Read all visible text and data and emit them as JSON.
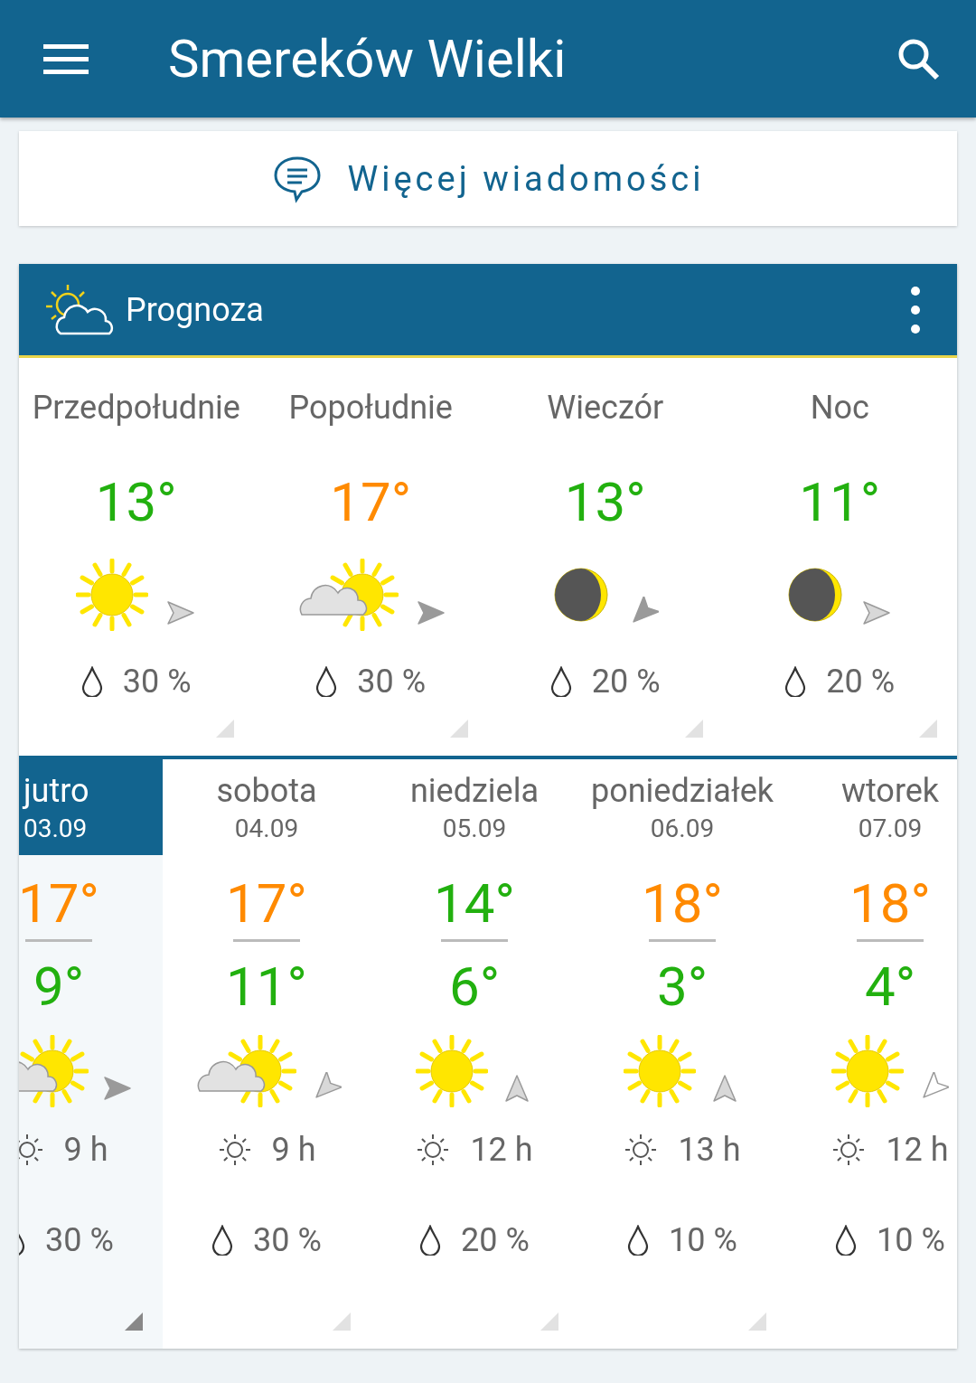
{
  "app_bar": {
    "title": "Smereków Wielki"
  },
  "news_card": {
    "label": "Więcej wiadomości"
  },
  "forecast": {
    "title": "Prognoza",
    "periods": [
      {
        "label": "Przedpołudnie",
        "temp": "13°",
        "color": "#22b00f",
        "precip": "30 %"
      },
      {
        "label": "Popołudnie",
        "temp": "17°",
        "color": "#ff8a00",
        "precip": "30 %"
      },
      {
        "label": "Wieczór",
        "temp": "13°",
        "color": "#22b00f",
        "precip": "20 %"
      },
      {
        "label": "Noc",
        "temp": "11°",
        "color": "#22b00f",
        "precip": "20 %"
      }
    ],
    "days": [
      {
        "name": "jutro",
        "date": "03.09",
        "selected": true,
        "max": "17°",
        "color": "#ff8a00",
        "min": "9°",
        "sun": "9 h",
        "precip": "30 %"
      },
      {
        "name": "sobota",
        "date": "04.09",
        "selected": false,
        "max": "17°",
        "color": "#ff8a00",
        "min": "11°",
        "sun": "9 h",
        "precip": "30 %"
      },
      {
        "name": "niedziela",
        "date": "05.09",
        "selected": false,
        "max": "14°",
        "color": "#22b00f",
        "min": "6°",
        "sun": "12 h",
        "precip": "20 %"
      },
      {
        "name": "poniedziałek",
        "date": "06.09",
        "selected": false,
        "max": "18°",
        "color": "#ff8a00",
        "min": "3°",
        "sun": "13 h",
        "precip": "10 %"
      },
      {
        "name": "wtorek",
        "date": "07.09",
        "selected": false,
        "max": "18°",
        "color": "#ff8a00",
        "min": "4°",
        "sun": "12 h",
        "precip": "10 %"
      }
    ]
  }
}
